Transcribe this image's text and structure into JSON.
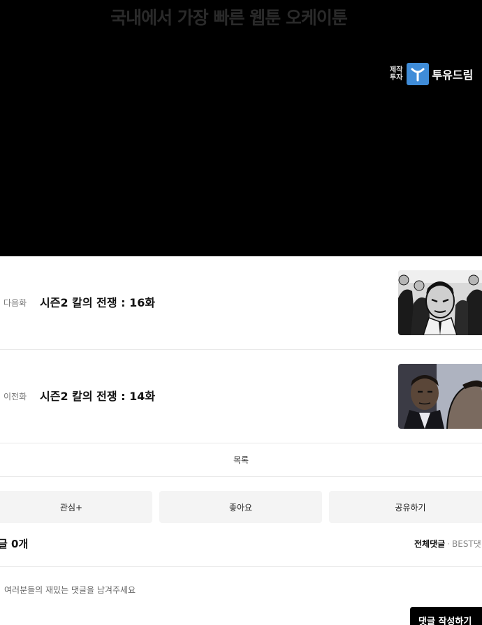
{
  "banner": {
    "headline": "국내에서 가장 빠른 웹툰 오케이툰",
    "sponsor_prefix_line1": "제작",
    "sponsor_prefix_line2": "투자",
    "sponsor_name": "투유드림",
    "logo_color": "#3f8cd8"
  },
  "episodes": {
    "next": {
      "tag": "다음화",
      "title": "시즌2 칼의 전쟁 : 16화"
    },
    "prev": {
      "tag": "이전화",
      "title": "시즌2 칼의 전쟁 : 14화"
    }
  },
  "list_label": "목록",
  "actions": {
    "favorite": "관심+",
    "like": "좋아요",
    "share": "공유하기"
  },
  "comments": {
    "count_label": "글 0개",
    "sort_all": "전체댓글",
    "sort_separator": "·",
    "sort_best": "BEST댓",
    "placeholder": "여러분들의 재밌는 댓글을 남겨주세요",
    "write_button": "댓글 작성하기"
  }
}
